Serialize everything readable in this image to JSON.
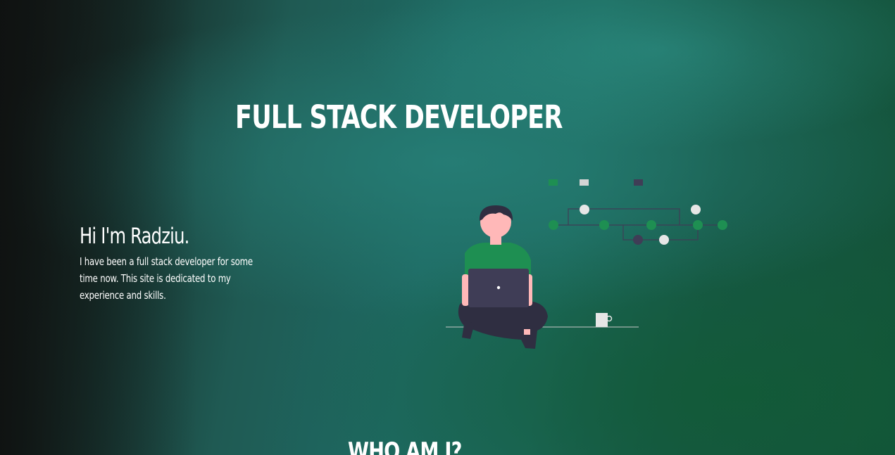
{
  "hero": {
    "title": "FULL STACK DEVELOPER"
  },
  "intro": {
    "heading": "Hi I'm Radziu.",
    "text": "I have been a full stack developer for some time now. This site is dedicated to my experience and skills."
  },
  "next_section": {
    "title": "WHO AM I?"
  },
  "colors": {
    "accent_green": "#1e8f52",
    "node_light": "#e6e6e6",
    "node_dark": "#3f3d56",
    "figure_dark": "#2f2e41",
    "skin": "#ffb8b8"
  }
}
